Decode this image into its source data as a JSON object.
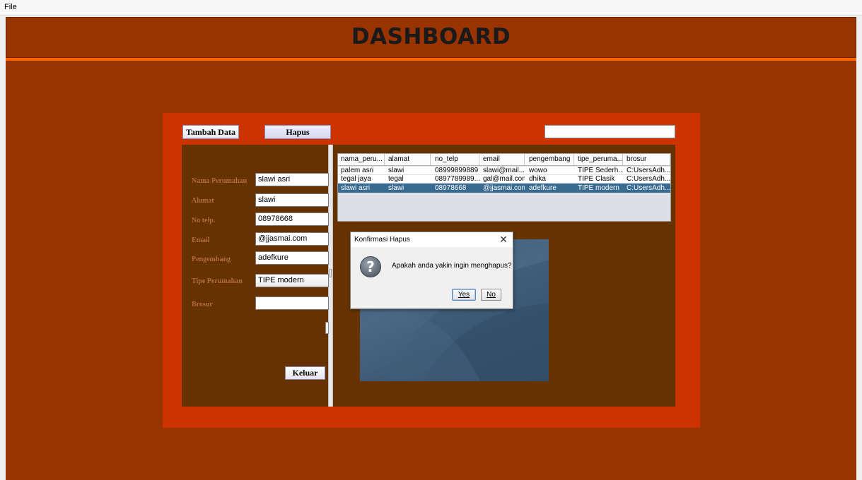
{
  "menubar": {
    "file_label": "File"
  },
  "header": {
    "title": "DASHBOARD"
  },
  "toolbar": {
    "tambah_label": "Tambah Data",
    "hapus_label": "Hapus",
    "search_value": ""
  },
  "form": {
    "fields": [
      {
        "label": "Nama Perumahan",
        "value": "slawi asri"
      },
      {
        "label": "Alamat",
        "value": "slawi"
      },
      {
        "label": "No telp.",
        "value": "08978668"
      },
      {
        "label": "Email",
        "value": "@jjasmai.com"
      },
      {
        "label": "Pengembang",
        "value": "adefkure"
      },
      {
        "label": "Tipe Perumahan",
        "value": "TIPE modern"
      },
      {
        "label": "Brosur",
        "value": ""
      }
    ],
    "keluar_label": "Keluar"
  },
  "table": {
    "columns": [
      "nama_peru...",
      "alamat",
      "no_telp",
      "email",
      "pengembang",
      "tipe_peruma...",
      "brosur"
    ],
    "rows": [
      [
        "palem asri",
        "slawi",
        "08999899889",
        "slawi@mail....",
        "wowo",
        "TIPE Sederh...",
        "C:UsersAdh..."
      ],
      [
        "tegal jaya",
        "tegal",
        "0897789989...",
        "gal@mail.com",
        "dhika",
        "TIPE Clasik",
        "C:UsersAdh..."
      ],
      [
        "slawi asri",
        "slawi",
        "08978668",
        "@jjasmai.com",
        "adefkure",
        "TIPE modern",
        "C:UsersAdh..."
      ]
    ],
    "selected_row": 2
  },
  "dialog": {
    "title": "Konfirmasi Hapus",
    "message": "Apakah anda yakin ingin menghapus?",
    "icon": "question-icon",
    "yes_label": "Yes",
    "no_label": "No",
    "close_glyph": "✕"
  },
  "colors": {
    "header_bg": "#993300",
    "accent_line": "#ff6600",
    "panel_bg": "#cc3300",
    "inner_bg": "#663300",
    "selection": "#386b8f"
  }
}
